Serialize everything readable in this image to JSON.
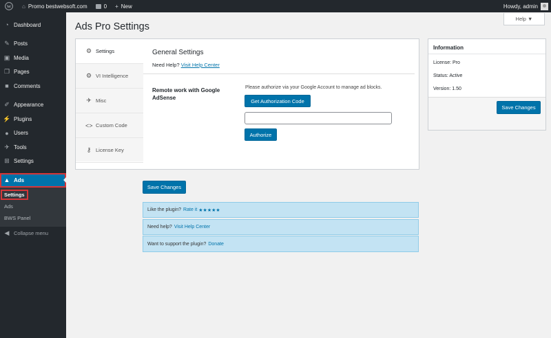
{
  "adminbar": {
    "site_name": "Promo bestwebsoft.com",
    "comments_count": "0",
    "new_label": "New",
    "greeting": "Howdy, admin"
  },
  "sidebar": {
    "items": [
      {
        "label": "Dashboard",
        "icon": "dashboard-icon"
      },
      {
        "label": "Posts",
        "icon": "pin-icon"
      },
      {
        "label": "Media",
        "icon": "media-icon"
      },
      {
        "label": "Pages",
        "icon": "pages-icon"
      },
      {
        "label": "Comments",
        "icon": "comments-icon"
      },
      {
        "label": "Appearance",
        "icon": "brush-icon"
      },
      {
        "label": "Plugins",
        "icon": "plugin-icon"
      },
      {
        "label": "Users",
        "icon": "users-icon"
      },
      {
        "label": "Tools",
        "icon": "wrench-icon"
      },
      {
        "label": "Settings",
        "icon": "settings-icon"
      },
      {
        "label": "Ads",
        "icon": "ads-icon"
      }
    ],
    "submenu": [
      "Settings",
      "Ads",
      "BWS Panel"
    ],
    "collapse_label": "Collapse menu"
  },
  "help_tab": "Help ▼",
  "page_title": "Ads Pro Settings",
  "tabs": [
    {
      "label": "Settings",
      "icon": "gear-icon"
    },
    {
      "label": "VI Intelligence",
      "icon": "cog-icon"
    },
    {
      "label": "Misc",
      "icon": "wrench-icon"
    },
    {
      "label": "Custom Code",
      "icon": "code-icon"
    },
    {
      "label": "License Key",
      "icon": "key-icon"
    }
  ],
  "general": {
    "title": "General Settings",
    "help_prefix": "Need Help?",
    "help_link": "Visit Help Center",
    "row_label": "Remote work with Google AdSense",
    "row_desc": "Please authorize via your Google Account to manage ad blocks.",
    "auth_button": "Get Authorization Code",
    "auth_value": "",
    "authorize_button": "Authorize"
  },
  "save_changes": "Save Changes",
  "notices": [
    {
      "text": "Like the plugin?",
      "link": "Rate it",
      "stars": "★★★★★"
    },
    {
      "text": "Need help?",
      "link": "Visit Help Center"
    },
    {
      "text": "Want to support the plugin?",
      "link": "Donate"
    }
  ],
  "info": {
    "title": "Information",
    "license": "License: Pro",
    "status": "Status: Active",
    "version": "Version: 1.50",
    "save_button": "Save Changes"
  },
  "colors": {
    "accent": "#0073aa",
    "highlight": "#d63638",
    "sidebar_bg": "#23282d",
    "notice_bg": "#c3e3f3"
  }
}
